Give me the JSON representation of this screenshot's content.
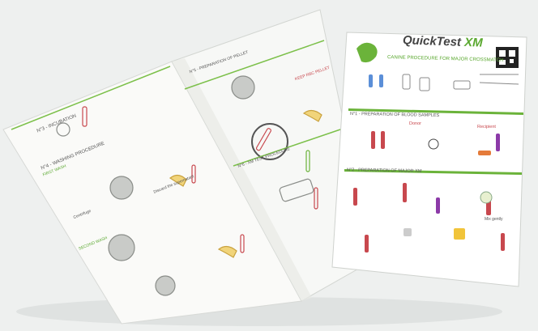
{
  "brand": {
    "logo": "QuickTest",
    "logo_suffix": "XM",
    "subtitle": "CANINE PROCEDURE FOR MAJOR CROSSMATCH",
    "accent": "#5aa82f"
  },
  "left_page": {
    "section_incubation": "N°3 - INCUBATION",
    "section_washing": "N°4 - WASHING PROCEDURE",
    "first_wash": "FIRST WASH",
    "second_wash": "SECOND WASH",
    "step_centrifuge": "Centrifuge",
    "step_discard": "Discard the supernatant"
  },
  "middle_page": {
    "section_pellet": "N°5 - PREPARATION OF PELLET",
    "keep_pellet": "KEEP RBC PELLET",
    "section_test": "N°6 - XM TEST PROCEDURE"
  },
  "right_page": {
    "section_blood": "N°1 - PREPARATION OF BLOOD SAMPLES",
    "donor": "Donor",
    "recipient": "Recipient",
    "section_major": "N°2 - PREPARATION OF MAJOR XM",
    "mix_gently": "Mix gently"
  }
}
